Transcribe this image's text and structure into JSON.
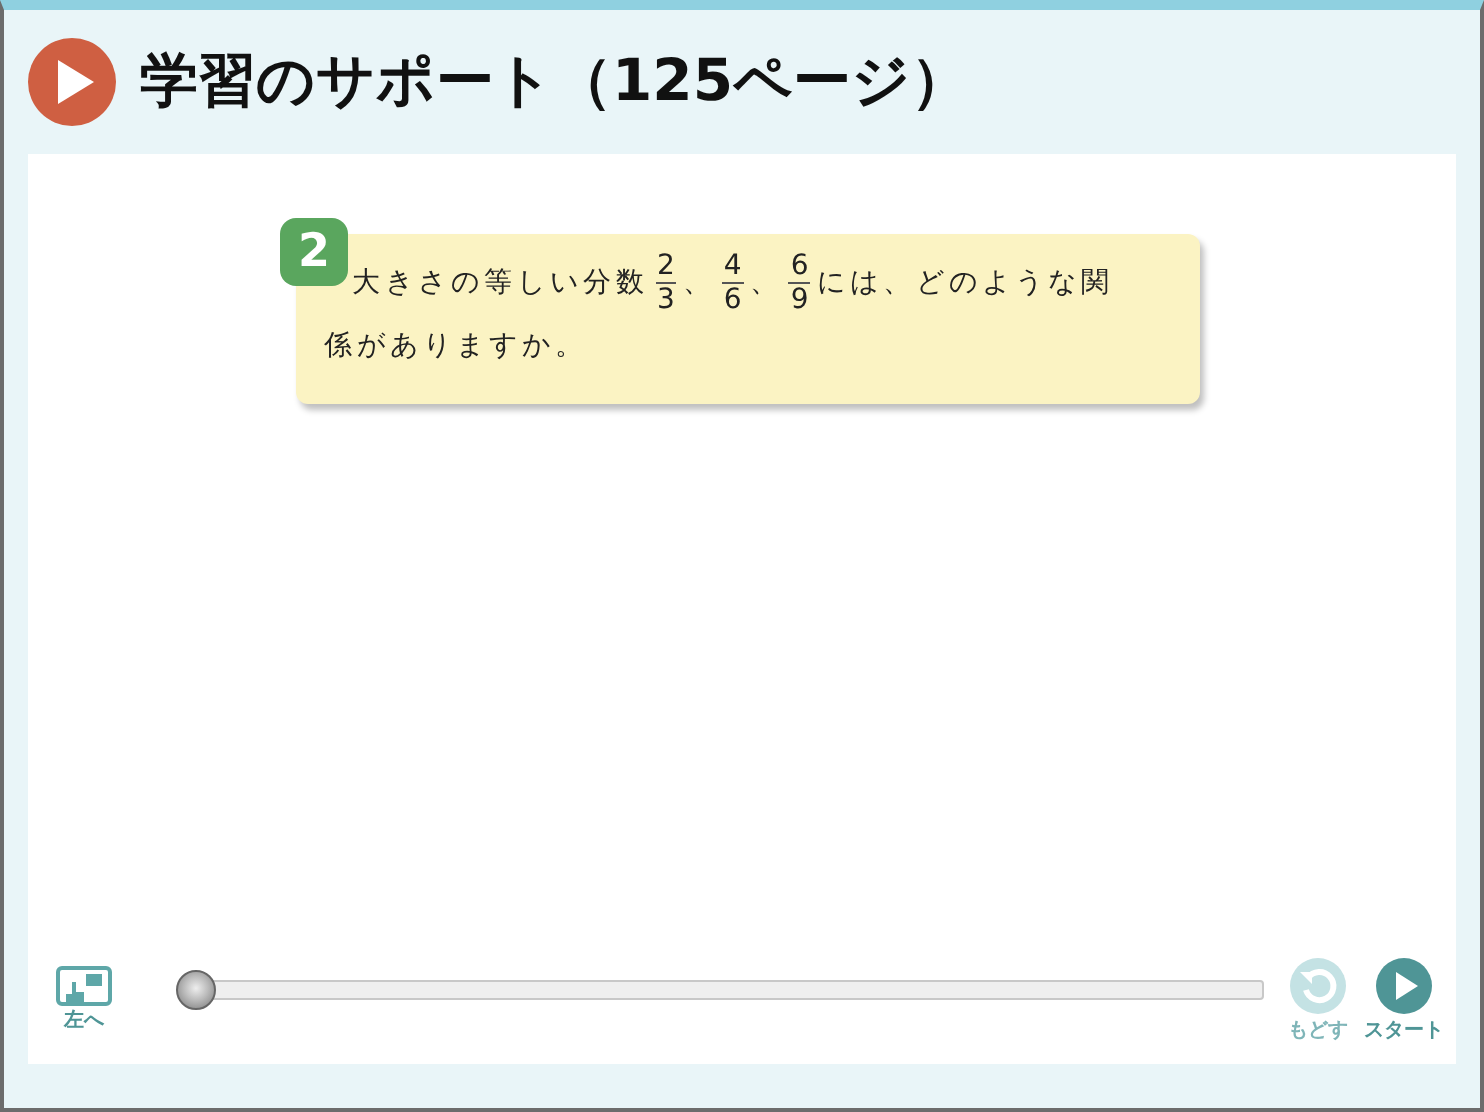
{
  "header": {
    "title": "学習のサポート（125ページ）"
  },
  "question": {
    "number": "2",
    "parts": [
      {
        "kind": "text",
        "text": "大きさの等しい分数"
      },
      {
        "kind": "fraction",
        "numerator": "2",
        "denominator": "3"
      },
      {
        "kind": "text",
        "text": "、"
      },
      {
        "kind": "fraction",
        "numerator": "4",
        "denominator": "6"
      },
      {
        "kind": "text",
        "text": "、"
      },
      {
        "kind": "fraction",
        "numerator": "6",
        "denominator": "9"
      },
      {
        "kind": "text",
        "text": "には、どのような関係がありますか。"
      }
    ]
  },
  "controls": {
    "left_button": {
      "label": "左へ"
    },
    "slider": {
      "level": 0
    },
    "reset_button": {
      "label": "もどす",
      "disabled": true
    },
    "start_button": {
      "label": "スタート",
      "disabled": false
    }
  }
}
